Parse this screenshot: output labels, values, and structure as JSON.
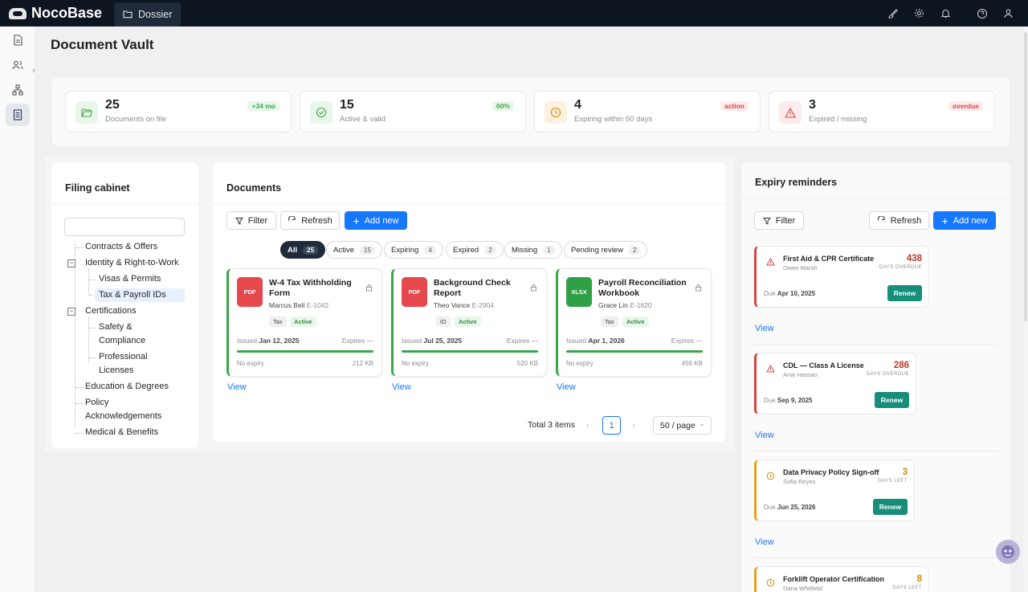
{
  "app": {
    "logo": "NocoBase",
    "nav_item": "Dossier"
  },
  "page": {
    "title": "Document Vault"
  },
  "stats": [
    {
      "value": "25",
      "label": "Documents on file",
      "badge": "+34 mo",
      "icon": "folder-open-icon",
      "color": "#3ca64c"
    },
    {
      "value": "15",
      "label": "Active & valid",
      "badge": "60%",
      "icon": "check-circle-icon",
      "color": "#3ca64c"
    },
    {
      "value": "4",
      "label": "Expiring within 60 days",
      "badge": "action",
      "icon": "clock-icon",
      "color": "#d48806"
    },
    {
      "value": "3",
      "label": "Expired / missing",
      "badge": "overdue",
      "icon": "warning-icon",
      "color": "#d64545"
    }
  ],
  "filing": {
    "title": "Filing cabinet",
    "search_placeholder": "",
    "nodes": [
      "Contracts & Offers",
      "Identity & Right-to-Work",
      "Visas & Permits",
      "Tax & Payroll IDs",
      "Certifications",
      "Safety &",
      "Compliance",
      "Professional",
      "Licenses",
      "Education & Degrees",
      "Policy",
      "Acknowledgements",
      "Medical & Benefits"
    ],
    "toggle_expanded": "−"
  },
  "documents": {
    "title": "Documents",
    "filter_label": "Filter",
    "refresh_label": "Refresh",
    "add_label": "Add new",
    "segments": [
      {
        "label": "All",
        "count": "25"
      },
      {
        "label": "Active",
        "count": "15"
      },
      {
        "label": "Expiring",
        "count": "4"
      },
      {
        "label": "Expired",
        "count": "2"
      },
      {
        "label": "Missing",
        "count": "1"
      },
      {
        "label": "Pending review",
        "count": "2"
      }
    ],
    "cards": [
      {
        "type": "PDF",
        "type_color": "#e5484d",
        "title": "W-4 Tax Withholding Form",
        "person": "Marcus Bell",
        "emp": "E-1042",
        "category": "Tax",
        "status": "Active",
        "issued_label": "Issued",
        "issued": "Jan 12, 2025",
        "expires": "Expires —",
        "no_expiry": "No expiry",
        "size": "212 KB",
        "progress": 1.0
      },
      {
        "type": "PDF",
        "type_color": "#e5484d",
        "title": "Background Check Report",
        "person": "Theo Vance",
        "emp": "E-2904",
        "category": "ID",
        "status": "Active",
        "issued_label": "Issued",
        "issued": "Jul 25, 2025",
        "expires": "Expires —",
        "no_expiry": "No expiry",
        "size": "520 KB",
        "progress": 1.0
      },
      {
        "type": "XLSX",
        "type_color": "#30a046",
        "title": "Payroll Reconciliation Workbook",
        "person": "Grace Lin",
        "emp": "E-1620",
        "category": "Tax",
        "status": "Active",
        "issued_label": "Issued",
        "issued": "Apr 1, 2026",
        "expires": "Expires —",
        "no_expiry": "No expiry",
        "size": "456 KB",
        "progress": 1.0
      }
    ],
    "view_label": "View",
    "pagination": {
      "total": "Total 3 items",
      "current": "1",
      "page_size": "50 / page"
    }
  },
  "reminders": {
    "title": "Expiry reminders",
    "filter_label": "Filter",
    "refresh_label": "Refresh",
    "add_label": "Add new",
    "view_label": "View",
    "items": [
      {
        "title": "First Aid & CPR Certificate",
        "person": "Owen Marsh",
        "num": "438",
        "unit": "DAYS OVERDUE",
        "due_label": "Due",
        "due": "Apr 10, 2025",
        "action": "Renew",
        "level": "danger"
      },
      {
        "title": "CDL — Class A License",
        "person": "Amir Hassan",
        "num": "286",
        "unit": "DAYS OVERDUE",
        "due_label": "Due",
        "due": "Sep 9, 2025",
        "action": "Renew",
        "level": "danger"
      },
      {
        "title": "Data Privacy Policy Sign-off",
        "person": "Sofia Reyes",
        "num": "3",
        "unit": "DAYS LEFT",
        "due_label": "Due",
        "due": "Jun 25, 2026",
        "action": "Renew",
        "level": "warn"
      },
      {
        "title": "Forklift Operator Certification",
        "person": "Dana Whitfield",
        "num": "8",
        "unit": "DAYS LEFT",
        "level": "warn"
      }
    ]
  },
  "colors": {
    "accent": "#1677ff",
    "topbar": "#0d1521",
    "success": "#3ca64c",
    "danger": "#d64545",
    "warning": "#d48806",
    "renew": "#178e7a"
  }
}
